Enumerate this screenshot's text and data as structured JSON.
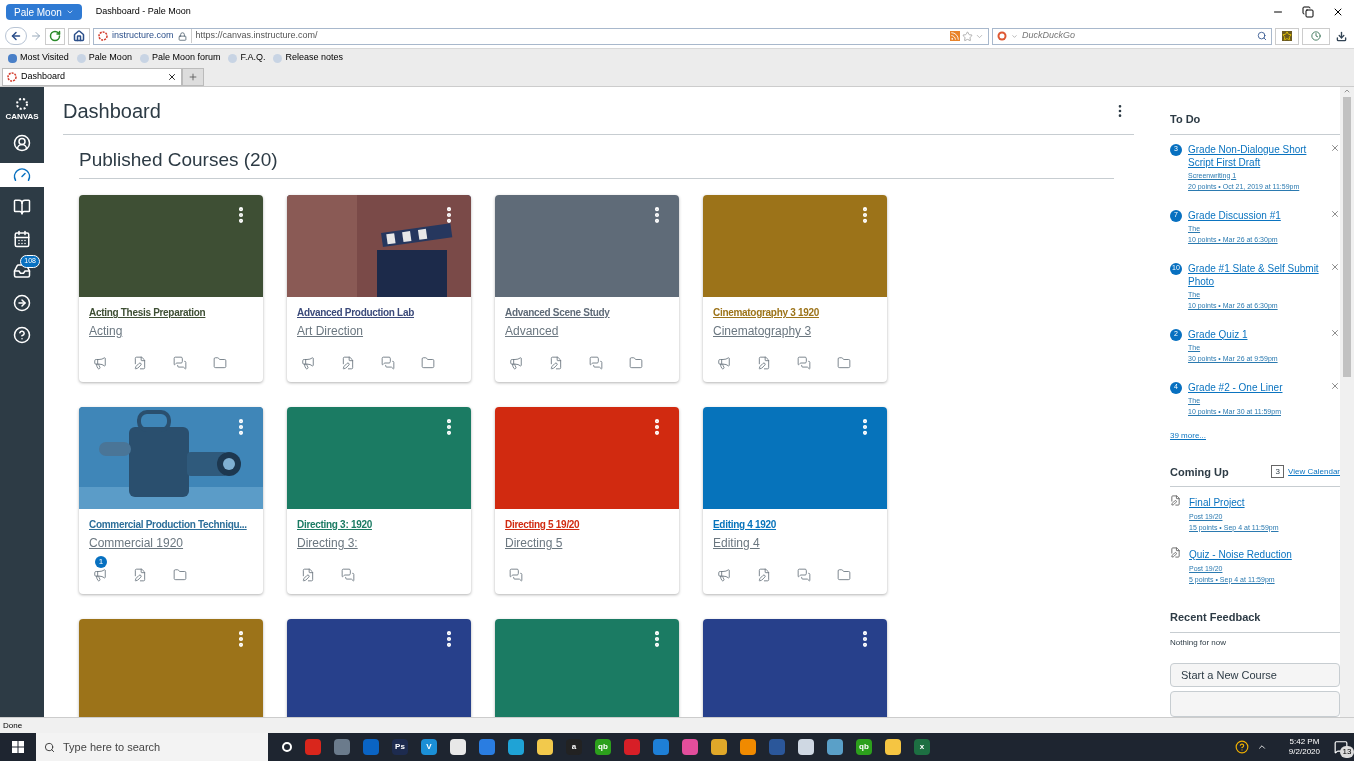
{
  "browser": {
    "menu_button": "Pale Moon",
    "title": "Dashboard - Pale Moon",
    "identity": "instructure.com",
    "url": "https://canvas.instructure.com/",
    "search_placeholder": "DuckDuckGo",
    "bookmarks": [
      "Most Visited",
      "Pale Moon",
      "Pale Moon forum",
      "F.A.Q.",
      "Release notes"
    ],
    "tabs": [
      {
        "label": "Dashboard",
        "selected": true
      }
    ],
    "status": "Done"
  },
  "sidebar": {
    "logo": "CANVAS",
    "items": [
      {
        "kind": "account",
        "selected": false
      },
      {
        "kind": "dashboard",
        "selected": true
      },
      {
        "kind": "courses",
        "selected": false
      },
      {
        "kind": "calendar",
        "selected": false
      },
      {
        "kind": "inbox",
        "selected": false,
        "badge": "108"
      },
      {
        "kind": "commons",
        "selected": false
      },
      {
        "kind": "help",
        "selected": false
      }
    ]
  },
  "dashboard": {
    "title": "Dashboard",
    "section": "Published Courses (20)",
    "cards": [
      {
        "title": "Acting Thesis Preparation",
        "subtitle": "Acting",
        "color": "#3e4f34",
        "picture": false,
        "icons": [
          {
            "kind": "announcement"
          },
          {
            "kind": "assignment"
          },
          {
            "kind": "discussion"
          },
          {
            "kind": "files"
          }
        ]
      },
      {
        "title": "Advanced Production Lab",
        "subtitle": "Art Direction",
        "color": "#3b4a7a",
        "picture": true,
        "icons": [
          {
            "kind": "announcement"
          },
          {
            "kind": "assignment"
          },
          {
            "kind": "discussion"
          },
          {
            "kind": "files"
          }
        ]
      },
      {
        "title": "Advanced Scene Study",
        "subtitle": "Advanced",
        "color": "#5f6b78",
        "picture": false,
        "icons": [
          {
            "kind": "announcement"
          },
          {
            "kind": "assignment"
          },
          {
            "kind": "discussion"
          },
          {
            "kind": "files"
          }
        ]
      },
      {
        "title": "Cinematography 3 1920",
        "subtitle": "Cinematography 3",
        "color": "#9c7319",
        "picture": false,
        "icons": [
          {
            "kind": "announcement"
          },
          {
            "kind": "assignment"
          },
          {
            "kind": "discussion"
          },
          {
            "kind": "files"
          }
        ]
      },
      {
        "title": "Commercial Production Techniqu...",
        "subtitle": "Commercial 1920",
        "color": "#2d6f9a",
        "picture": true,
        "icons": [
          {
            "kind": "announcement",
            "badge": "1"
          },
          {
            "kind": "assignment"
          },
          {
            "kind": "files"
          }
        ]
      },
      {
        "title": "Directing 3: 1920",
        "subtitle": "Directing 3:",
        "color": "#1b7b63",
        "picture": false,
        "icons": [
          {
            "kind": "assignment"
          },
          {
            "kind": "discussion"
          }
        ]
      },
      {
        "title": "Directing 5 19/20",
        "subtitle": "Directing 5",
        "color": "#d12a10",
        "picture": false,
        "icons": [
          {
            "kind": "discussion"
          }
        ]
      },
      {
        "title": "Editing 4 1920",
        "subtitle": "Editing 4",
        "color": "#0673bb",
        "picture": false,
        "icons": [
          {
            "kind": "announcement"
          },
          {
            "kind": "assignment"
          },
          {
            "kind": "discussion"
          },
          {
            "kind": "files"
          }
        ]
      },
      {
        "color": "#9c7319",
        "picture": false
      },
      {
        "color": "#27408b",
        "picture": false
      },
      {
        "color": "#1b7b63",
        "picture": false
      },
      {
        "color": "#27408b",
        "picture": false
      }
    ]
  },
  "todo": {
    "title": "To Do",
    "items": [
      {
        "count": "3",
        "title": "Grade Non-Dialogue Short Script First Draft",
        "course": "Screenwriting 1",
        "details": "20 points • Oct 21, 2019 at 11:59pm"
      },
      {
        "count": "7",
        "title": "Grade Discussion #1",
        "course": "The",
        "details": "10 points • Mar 26 at 6:30pm"
      },
      {
        "count": "10",
        "title": "Grade #1 Slate & Self Submit Photo",
        "course": "The",
        "details": "10 points • Mar 26 at 6:30pm"
      },
      {
        "count": "2",
        "title": "Grade Quiz 1",
        "course": "The",
        "details": "30 points • Mar 26 at 9:59pm"
      },
      {
        "count": "4",
        "title": "Grade #2 - One Liner",
        "course": "The",
        "details": "10 points • Mar 30 at 11:59pm"
      }
    ],
    "more": "39 more..."
  },
  "coming_up": {
    "title": "Coming Up",
    "calendar_day": "3",
    "calendar_link": "View Calendar",
    "items": [
      {
        "title": "Final Project",
        "course": "Post 19/20",
        "details": "15 points • Sep 4 at 11:59pm"
      },
      {
        "title": "Quiz - Noise Reduction",
        "course": "Post 19/20",
        "details": "5 points • Sep 4 at 11:59pm"
      }
    ]
  },
  "feedback": {
    "title": "Recent Feedback",
    "empty": "Nothing for now"
  },
  "actions": [
    "Start a New Course"
  ],
  "taskbar": {
    "search_placeholder": "Type here to search",
    "time": "5:42 PM",
    "date": "9/2/2020",
    "notifications": "13",
    "apps": [
      {
        "color": "#d9261c"
      },
      {
        "color": "#6b7b8c"
      },
      {
        "color": "#0a64c4"
      },
      {
        "color": "#1d2b4f",
        "label": "Ps"
      },
      {
        "color": "#1b8fd6",
        "label": "V"
      },
      {
        "color": "#e8e8e8"
      },
      {
        "color": "#2a7de1"
      },
      {
        "color": "#1fa3d6"
      },
      {
        "color": "#f2c94c"
      },
      {
        "color": "#222222",
        "label": "a"
      },
      {
        "color": "#2ca01c",
        "label": "qb"
      },
      {
        "color": "#d71f27"
      },
      {
        "color": "#1e7fd6"
      },
      {
        "color": "#e24e9c"
      },
      {
        "color": "#e0a829"
      },
      {
        "color": "#f08a00"
      },
      {
        "color": "#2b579a"
      },
      {
        "color": "#cfd8e3"
      },
      {
        "color": "#5aa0c8"
      },
      {
        "color": "#2ca01c",
        "label": "qb"
      },
      {
        "color": "#f5c542"
      },
      {
        "color": "#1d6f42",
        "label": "x"
      }
    ]
  }
}
